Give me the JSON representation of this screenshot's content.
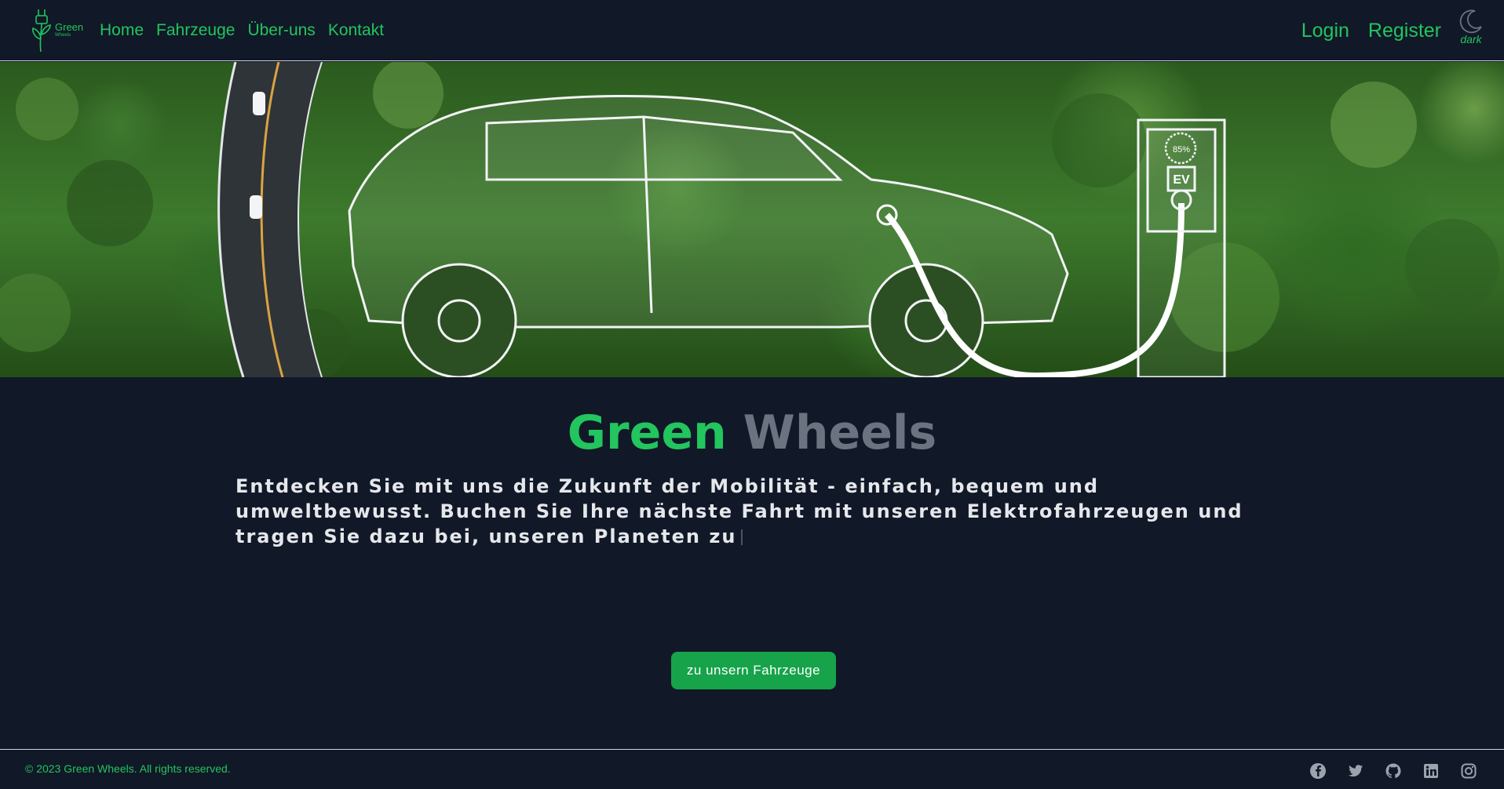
{
  "brand": {
    "name": "Green",
    "sub": "Wheels"
  },
  "nav": {
    "items": [
      {
        "label": "Home"
      },
      {
        "label": "Fahrzeuge"
      },
      {
        "label": "Über-uns"
      },
      {
        "label": "Kontakt"
      }
    ],
    "login": "Login",
    "register": "Register",
    "theme_label": "dark"
  },
  "hero": {
    "charger_label": "EV",
    "charge_level": "85%"
  },
  "main": {
    "title_green": "Green",
    "title_rest": "Wheels",
    "tagline": "Entdecken Sie mit uns die Zukunft der Mobilität - einfach, bequem und umweltbewusst. Buchen Sie Ihre nächste Fahrt mit unseren Elektrofahrzeugen und tragen Sie dazu bei, unseren Planeten zu",
    "cta_label": "zu unsern Fahrzeuge"
  },
  "footer": {
    "copyright": "© 2023 Green Wheels. All rights reserved.",
    "socials": [
      "facebook-icon",
      "twitter-icon",
      "github-icon",
      "linkedin-icon",
      "instagram-icon"
    ]
  },
  "colors": {
    "background": "#111827",
    "accent": "#22c55e",
    "button": "#16a34a",
    "muted": "#6b7280"
  }
}
